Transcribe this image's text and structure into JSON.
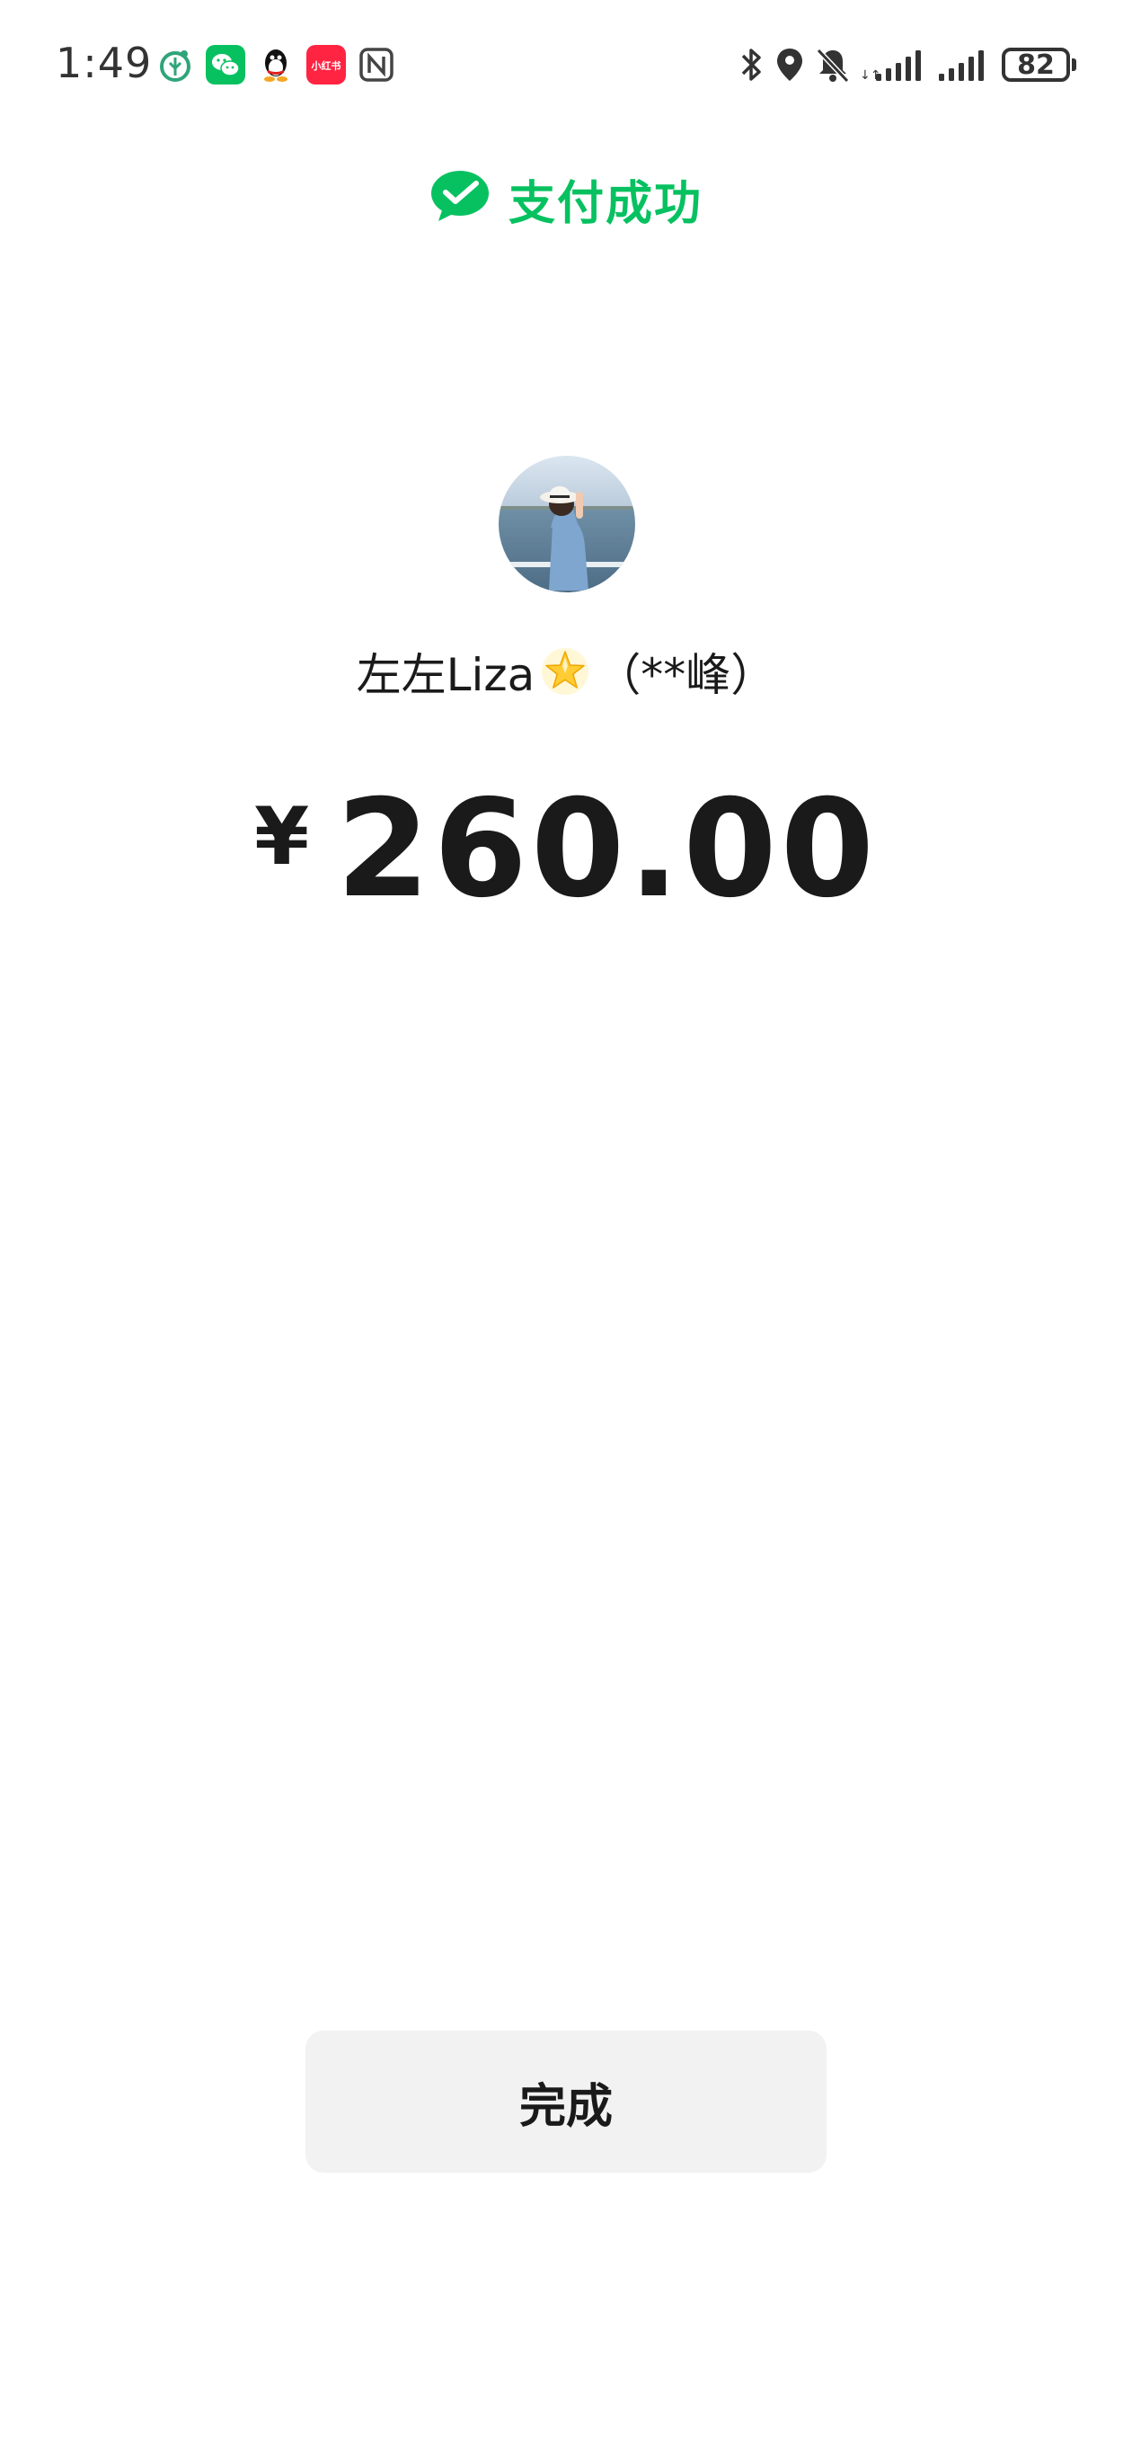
{
  "status_bar": {
    "time": "1:49",
    "battery_level": "82",
    "left_icons": [
      "eco-app-icon",
      "wechat-icon",
      "qq-icon",
      "xiaohongshu-icon",
      "nfc-icon"
    ],
    "xiaohongshu_label": "小红书",
    "right_icons": [
      "bluetooth-icon",
      "location-icon",
      "mute-icon",
      "signal-1-icon",
      "signal-2-icon",
      "battery-icon"
    ]
  },
  "header": {
    "title": "支付成功",
    "icon": "wechat-pay-check-icon"
  },
  "payee": {
    "nickname": "左左Liza",
    "real_name": "（**峰）",
    "emoji": "glowing-star-icon"
  },
  "payment": {
    "currency_symbol": "¥",
    "amount": "260.00"
  },
  "actions": {
    "done_label": "完成"
  },
  "colors": {
    "brand_green": "#07C160",
    "text_primary": "#1a1a1a",
    "button_bg": "#f2f2f2",
    "status_icon": "#333333"
  }
}
